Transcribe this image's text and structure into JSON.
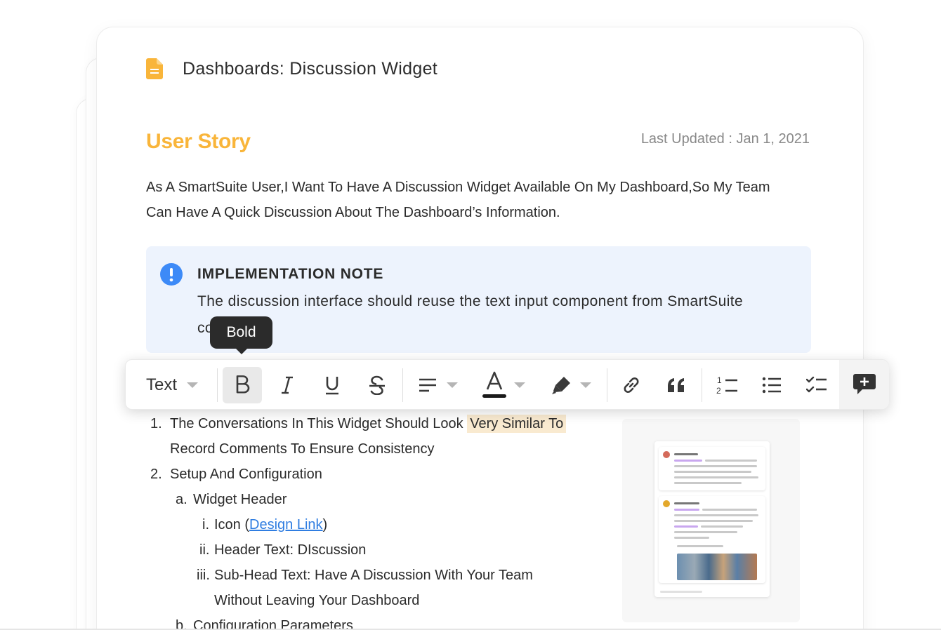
{
  "document": {
    "title": "Dashboards: Discussion Widget",
    "icon": "document-icon",
    "icon_color": "#f9b53a"
  },
  "section": {
    "title": "User Story",
    "title_color": "#f9b53a",
    "last_updated": "Last Updated : Jan 1, 2021"
  },
  "intro": {
    "line1": "As A SmartSuite User,I Want To Have A Discussion Widget Available On My Dashboard,So My Team",
    "line2": "Can Have A Quick Discussion About The Dashboard’s Information."
  },
  "note": {
    "icon": "info-icon",
    "icon_color": "#3d8af7",
    "heading": "IMPLEMENTATION NOTE",
    "line1": "The discussion interface should reuse the text input component from SmartSuite",
    "line2_start": "co",
    "line2_end": "."
  },
  "tooltip": {
    "label": "Bold"
  },
  "toolbar": {
    "block_type": "Text",
    "buttons": [
      "bold-icon",
      "italic-icon",
      "underline-icon",
      "strikethrough-icon",
      "align-left-icon",
      "text-color-icon",
      "highlight-icon",
      "link-icon",
      "quote-icon",
      "numbered-list-icon",
      "bulleted-list-icon",
      "checklist-icon",
      "add-comment-icon"
    ],
    "text_color_swatch": "#1a1a1a"
  },
  "list": {
    "item1_marker": "1.",
    "item1_text_a": "The Conversations In This Widget Should Look",
    "item1_text_highlight": "Very Similar To",
    "item1_text_b": "Record Comments To Ensure Consistency",
    "item2_marker": "2.",
    "item2_text": "Setup And Configuration",
    "item2a_marker": "a.",
    "item2a_text": "Widget Header",
    "item2ai_marker": "i.",
    "item2ai_text_a": "Icon (",
    "item2ai_link": "Design Link",
    "item2ai_text_b": ")",
    "item2aii_marker": "ii.",
    "item2aii_text": "Header Text: DIscussion",
    "item2aiii_marker": "iii.",
    "item2aiii_text_a": "Sub-Head Text: Have A Discussion With Your Team",
    "item2aiii_text_b": "Without Leaving Your Dashboard",
    "item2b_marker": "b.",
    "item2b_text": "Configuration Parameters"
  }
}
